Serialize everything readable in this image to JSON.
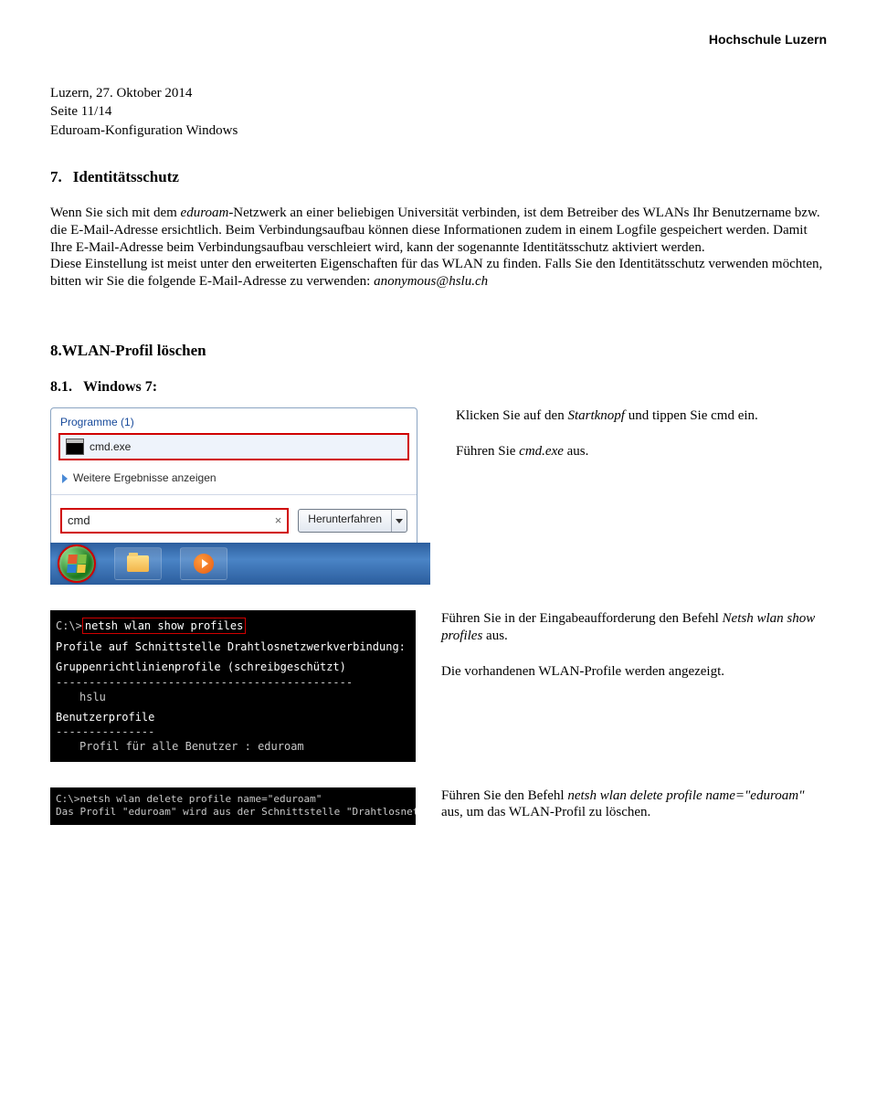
{
  "header_right": "Hochschule Luzern",
  "pre_header": {
    "date_line": "Luzern, 27. Oktober 2014",
    "page_line": "Seite 11/14",
    "doc_line": "Eduroam-Konfiguration Windows"
  },
  "section7": {
    "num": "7.",
    "title": "Identitätsschutz",
    "para_parts": {
      "p1a": "Wenn Sie sich mit dem ",
      "p1_em1": "eduroam",
      "p1b": "-Netzwerk an einer beliebigen Universität verbinden, ist dem Betreiber des WLANs Ihr Benutzername bzw. die E-Mail-Adresse ersichtlich. Beim Verbindungsaufbau können diese Informationen zudem in einem Logfile gespeichert werden. Damit Ihre E-Mail-Adresse beim Verbindungsaufbau verschleiert wird, kann der sogenannte Identitätsschutz aktiviert werden.",
      "p2": "Diese Einstellung ist meist unter den erweiterten Eigenschaften für das WLAN zu finden. Falls Sie den Identitätsschutz verwenden möchten, bitten wir Sie die folgende E-Mail-Adresse zu verwenden: ",
      "p2_em": "anonymous@hslu.ch"
    }
  },
  "section8": {
    "num": "8.",
    "title": "WLAN-Profil löschen",
    "sub_num": "8.1.",
    "sub_title": "Windows 7:"
  },
  "startmenu": {
    "group_title": "Programme (1)",
    "cmd_label": "cmd.exe",
    "more_results": "Weitere Ergebnisse anzeigen",
    "search_value": "cmd",
    "shutdown": "Herunterfahren"
  },
  "step1": {
    "line1a": "Klicken Sie auf den ",
    "line1_em": "Startknopf",
    "line1b": " und tippen Sie cmd ein.",
    "line2a": "Führen Sie ",
    "line2_em": "cmd.exe",
    "line2b": " aus."
  },
  "cmd1": {
    "prompt": "C:\\>",
    "highlight": "netsh wlan show profiles",
    "l1": "Profile auf Schnittstelle Drahtlosnetzwerkverbindung:",
    "l2": "Gruppenrichtlinienprofile (schreibgeschützt)",
    "dash1": "---------------------------------------------",
    "l3": "hslu",
    "l4": "Benutzerprofile",
    "dash2": "---------------",
    "l5": "Profil für alle Benutzer : eduroam"
  },
  "step2": {
    "line1a": "Führen Sie in der Eingabeaufforderung den Befehl ",
    "line1_em": "Netsh wlan show profiles",
    "line1b": " aus.",
    "line2": "Die vorhandenen WLAN-Profile werden angezeigt."
  },
  "cmd2": {
    "prompt": "C:\\>",
    "highlight": "netsh wlan delete profile name=\"eduroam\"",
    "result": "Das Profil \"eduroam\" wird aus der Schnittstelle \"Drahtlosnetzwerkverbindung\" gelöscht."
  },
  "step3": {
    "line1a": "Führen Sie den Befehl ",
    "line1_em": "netsh wlan delete profile name=\"eduroam\"",
    "line1b": " aus, um das WLAN-Profil zu löschen."
  }
}
